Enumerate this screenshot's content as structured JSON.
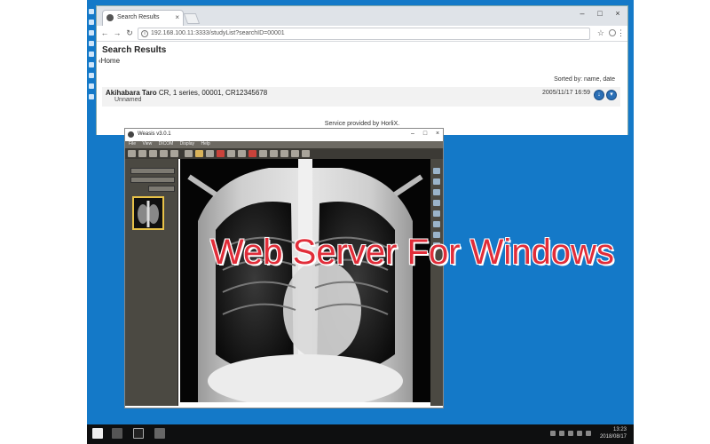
{
  "browser": {
    "tab_title": "Search Results",
    "url": "192.168.100.11:3333/studyList?searchID=00001"
  },
  "page": {
    "title": "Search Results",
    "home_link": "Home",
    "sorted_by": "Sorted by: name, date",
    "result": {
      "name": "Akihabara Taro",
      "details": "CR, 1 series, 00001, CR12345678",
      "sub": "Unnamed",
      "date": "2005/11/17 16:59"
    },
    "service": "Service provided by HorliX."
  },
  "viewer": {
    "title": "Weasis v3.0.1",
    "menu": [
      "File",
      "View",
      "DICOM",
      "Display",
      "Help"
    ]
  },
  "overlay_title": "Web Server For Windows",
  "taskbar": {
    "time": "13:23",
    "date": "2018/08/17"
  },
  "colors": {
    "desktop": "#1479c8",
    "overlay_text": "#e12d39",
    "accent_border": "#e8c248"
  }
}
